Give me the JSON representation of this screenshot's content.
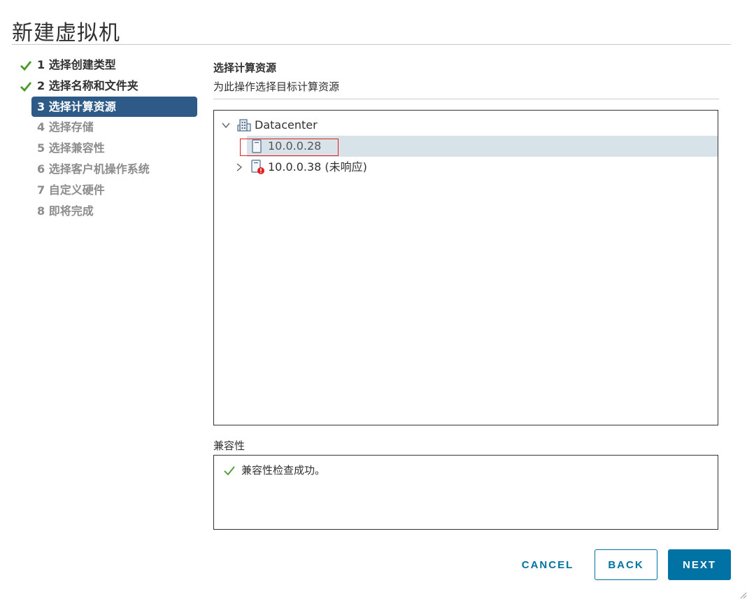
{
  "dialog": {
    "title": "新建虚拟机"
  },
  "steps": [
    {
      "label": "1 选择创建类型",
      "state": "done"
    },
    {
      "label": "2 选择名称和文件夹",
      "state": "done"
    },
    {
      "label": "3 选择计算资源",
      "state": "active"
    },
    {
      "label": "4 选择存储",
      "state": "todo"
    },
    {
      "label": "5 选择兼容性",
      "state": "todo"
    },
    {
      "label": "6 选择客户机操作系统",
      "state": "todo"
    },
    {
      "label": "7 自定义硬件",
      "state": "todo"
    },
    {
      "label": "8 即将完成",
      "state": "todo"
    }
  ],
  "main": {
    "title": "选择计算资源",
    "subtitle": "为此操作选择目标计算资源"
  },
  "tree": {
    "root": {
      "label": "Datacenter",
      "icon": "datacenter-icon",
      "expanded": true
    },
    "hosts": [
      {
        "label": "10.0.0.28",
        "icon": "host-icon",
        "selected": true
      },
      {
        "label": "10.0.0.38 (未响应)",
        "icon": "host-error-icon",
        "expanded": false
      }
    ]
  },
  "compatibility": {
    "label": "兼容性",
    "message": "兼容性检查成功。"
  },
  "buttons": {
    "cancel": "CANCEL",
    "back": "BACK",
    "next": "NEXT"
  },
  "colors": {
    "accent": "#0072a3",
    "active_step": "#2e5a87",
    "success": "#4a9a2a",
    "selected_row": "#d8e3e9",
    "error": "#e02020"
  }
}
